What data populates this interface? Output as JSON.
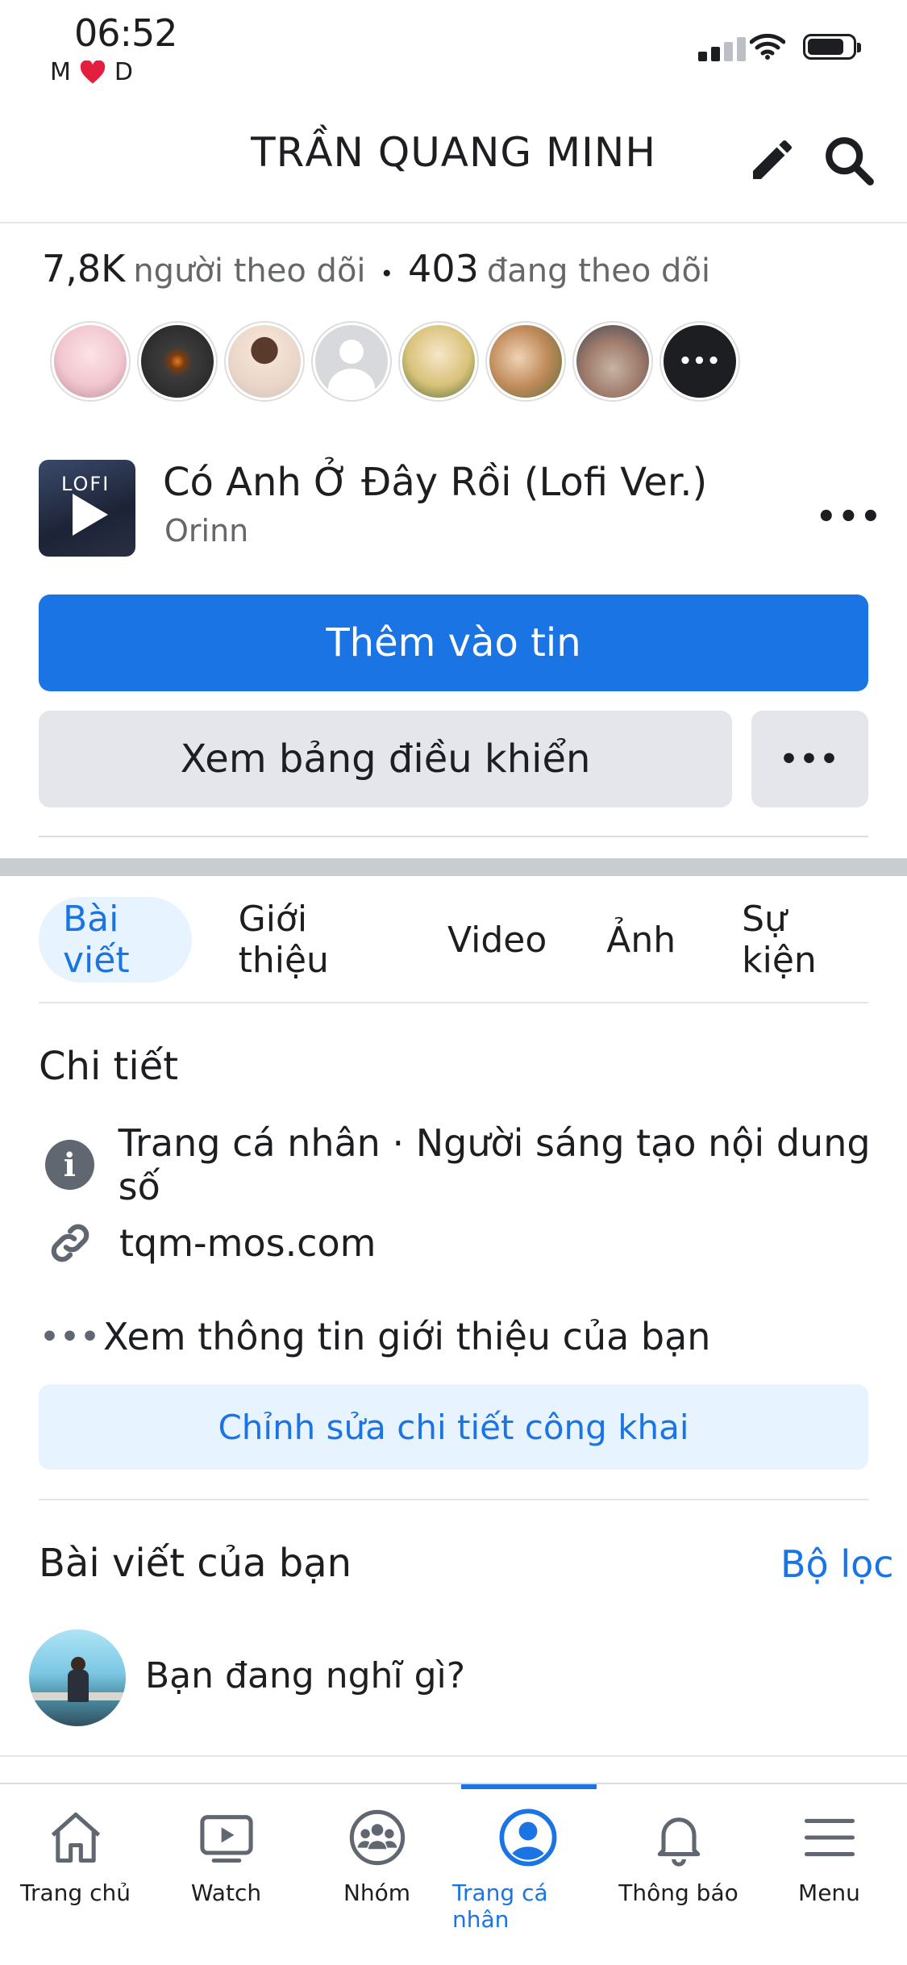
{
  "status": {
    "time": "06:52",
    "carrier_left": "M",
    "carrier_right": "D"
  },
  "header": {
    "title": "TRẦN QUANG MINH"
  },
  "followers": {
    "count": "7,8K",
    "count_label": "người theo dõi",
    "separator": "•",
    "following": "403",
    "following_label": "đang theo dõi"
  },
  "follower_avatar_colors": [
    "#f2c6cf",
    "#3b3b3b",
    "#e9d6c8",
    "#d7d9dd",
    "#d9c27a",
    "#c08a5a",
    "#9e7a6a"
  ],
  "music": {
    "cover_text": "LOFI",
    "song": "Có Anh Ở Đây Rồi (Lofi Ver.)",
    "artist": "Orinn",
    "more": "•••"
  },
  "buttons": {
    "add_story": "Thêm vào tin",
    "dashboard": "Xem bảng điều khiển",
    "more": "•••"
  },
  "tabs": [
    {
      "label": "Bài viết"
    },
    {
      "label": "Giới thiệu"
    },
    {
      "label": "Video"
    },
    {
      "label": "Ảnh"
    },
    {
      "label": "Sự kiện"
    }
  ],
  "details": {
    "title": "Chi tiết",
    "rows": [
      {
        "text": "Trang cá nhân · Người sáng tạo nội dung số",
        "icon": "info-icon"
      },
      {
        "text": "tqm-mos.com",
        "icon": "link-icon"
      },
      {
        "text": "Xem thông tin giới thiệu của bạn",
        "icon": "more-dots-icon"
      }
    ],
    "edit_button": "Chỉnh sửa chi tiết công khai"
  },
  "posts": {
    "title": "Bài viết của bạn",
    "filter": "Bộ lọc",
    "composer_placeholder": "Bạn đang nghĩ gì?"
  },
  "bottom_nav": [
    {
      "label": "Trang chủ",
      "icon": "home-icon"
    },
    {
      "label": "Watch",
      "icon": "watch-icon"
    },
    {
      "label": "Nhóm",
      "icon": "groups-icon"
    },
    {
      "label": "Trang cá nhân",
      "icon": "profile-icon"
    },
    {
      "label": "Thông báo",
      "icon": "bell-icon"
    },
    {
      "label": "Menu",
      "icon": "menu-icon"
    }
  ],
  "colors": {
    "accent": "#1b74e4",
    "light_accent": "#e7f3ff",
    "grey_button": "#e4e6eb",
    "heart": "#e41e3f"
  }
}
